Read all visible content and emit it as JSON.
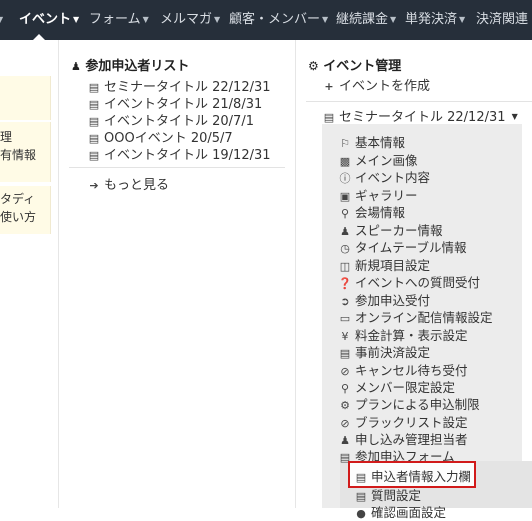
{
  "nav": {
    "items": [
      {
        "label": "イベント",
        "active": true
      },
      {
        "label": "フォーム"
      },
      {
        "label": "メルマガ"
      },
      {
        "label": "顧客・メンバー"
      },
      {
        "label": "継続課金"
      },
      {
        "label": "単発決済"
      },
      {
        "label": "決済関連"
      }
    ]
  },
  "left_cut": {
    "line1": "理",
    "line2": "有情報",
    "line3": "タディ",
    "line4": "使い方"
  },
  "participant_list": {
    "title": "参加申込者リスト",
    "items": [
      "セミナータイトル 22/12/31",
      "イベントタイトル 21/8/31",
      "イベントタイトル 20/7/1",
      "OOOイベント 20/5/7",
      "イベントタイトル 19/12/31"
    ],
    "more": "もっと見る"
  },
  "event_mgmt": {
    "title": "イベント管理",
    "create": "イベントを作成",
    "selected_event": "セミナータイトル 22/12/31",
    "menu": [
      {
        "label": "基本情報",
        "icon": "flag-icon"
      },
      {
        "label": "メイン画像",
        "icon": "image-icon"
      },
      {
        "label": "イベント内容",
        "icon": "info-icon"
      },
      {
        "label": "ギャラリー",
        "icon": "gallery-icon"
      },
      {
        "label": "会場情報",
        "icon": "map-marker-icon"
      },
      {
        "label": "スピーカー情報",
        "icon": "user-icon"
      },
      {
        "label": "タイムテーブル情報",
        "icon": "clock-icon"
      },
      {
        "label": "新規項目設定",
        "icon": "columns-icon"
      },
      {
        "label": "イベントへの質問受付",
        "icon": "question-icon"
      },
      {
        "label": "参加申込受付",
        "icon": "arrow-circle-icon"
      },
      {
        "label": "オンライン配信情報設定",
        "icon": "monitor-icon"
      },
      {
        "label": "料金計算・表示設定",
        "icon": "yen-icon"
      },
      {
        "label": "事前決済設定",
        "icon": "credit-card-icon"
      },
      {
        "label": "キャンセル待ち受付",
        "icon": "ban-icon"
      },
      {
        "label": "メンバー限定設定",
        "icon": "key-icon"
      },
      {
        "label": "プランによる申込制限",
        "icon": "gear-icon"
      },
      {
        "label": "ブラックリスト設定",
        "icon": "ban-icon"
      },
      {
        "label": "申し込み管理担当者",
        "icon": "users-icon"
      },
      {
        "label": "参加申込フォーム",
        "icon": "form-icon"
      }
    ],
    "form_sub": [
      {
        "label": "申込者情報入力欄",
        "icon": "form-icon"
      },
      {
        "label": "質問設定",
        "icon": "form-icon"
      },
      {
        "label": "確認画面設定",
        "icon": "circle-icon"
      }
    ]
  }
}
